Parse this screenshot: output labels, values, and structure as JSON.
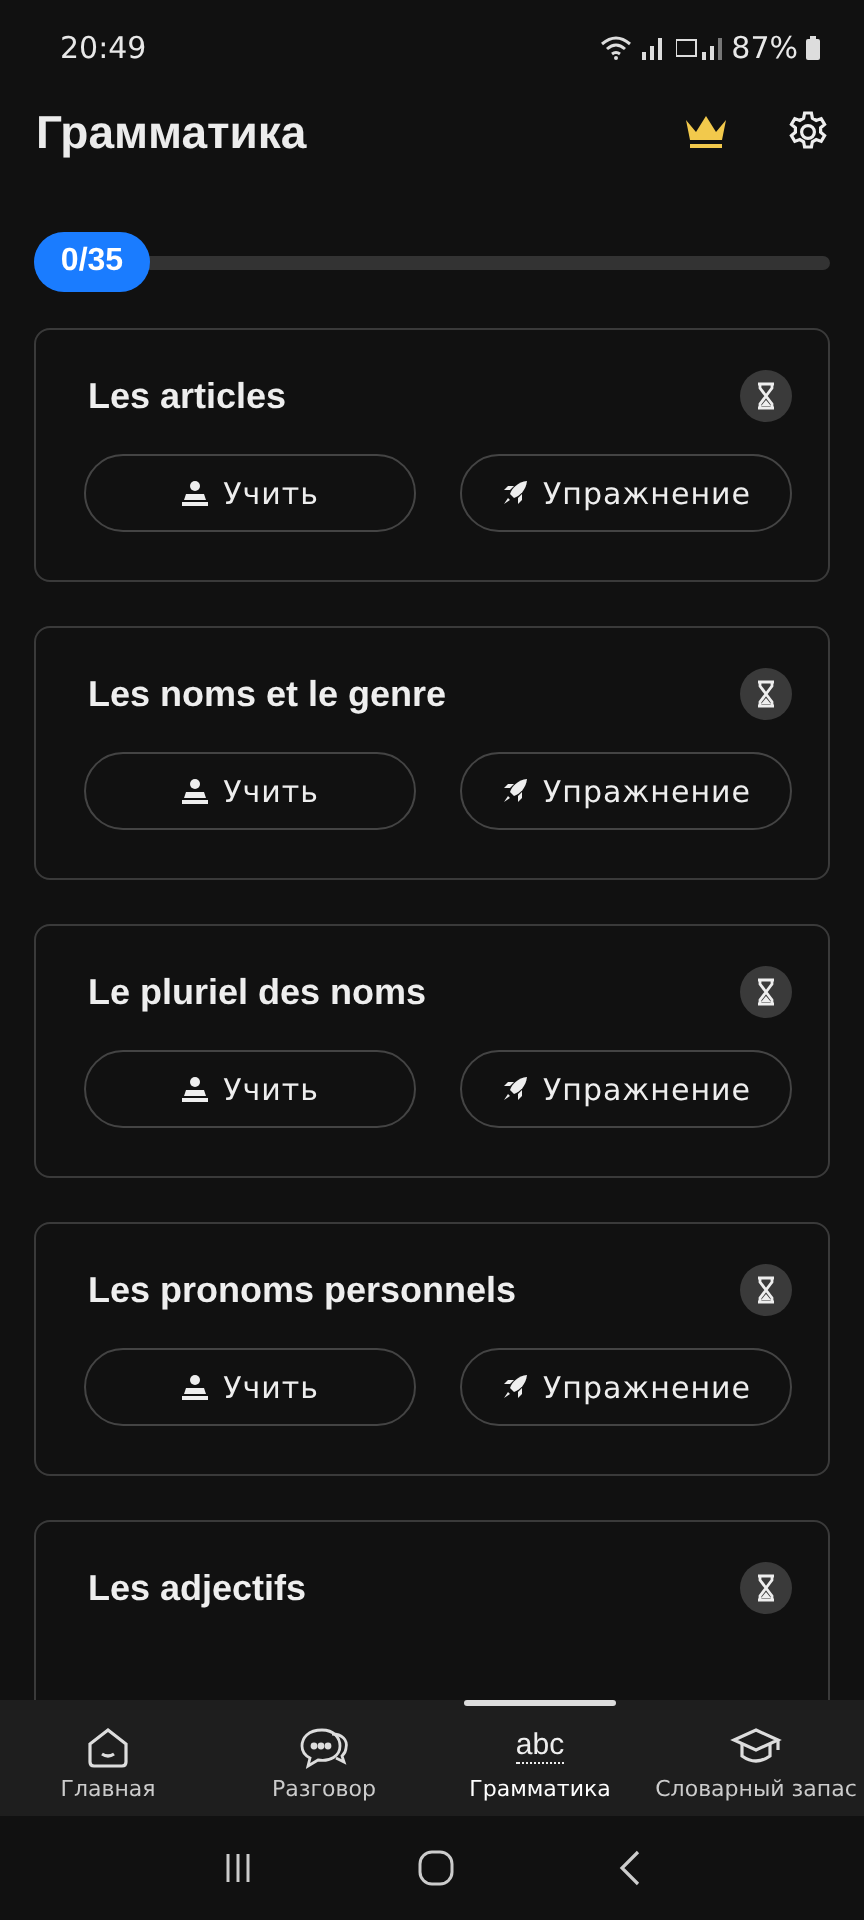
{
  "status_bar": {
    "time": "20:49",
    "battery": "87%"
  },
  "header": {
    "title": "Грамматика"
  },
  "progress": {
    "label": "0/35",
    "level": 0
  },
  "lessons": [
    {
      "title": "Les articles",
      "buttons": [
        {
          "kind": "learn",
          "label": "Учить"
        },
        {
          "kind": "practice",
          "label": "Упражнение"
        }
      ]
    },
    {
      "title": "Les noms et le genre",
      "buttons": [
        {
          "kind": "learn",
          "label": "Учить"
        },
        {
          "kind": "practice",
          "label": "Упражнение"
        }
      ]
    },
    {
      "title": "Le pluriel des noms",
      "buttons": [
        {
          "kind": "learn",
          "label": "Учить"
        },
        {
          "kind": "practice",
          "label": "Упражнение"
        }
      ]
    },
    {
      "title": "Les pronoms personnels",
      "buttons": [
        {
          "kind": "learn",
          "label": "Учить"
        },
        {
          "kind": "practice",
          "label": "Упражнение"
        }
      ]
    },
    {
      "title": "Les adjectifs"
    }
  ],
  "tabs": [
    {
      "kind": "home",
      "label": "Главная",
      "selected": false
    },
    {
      "kind": "chat",
      "label": "Разговор",
      "selected": false
    },
    {
      "kind": "abc",
      "icon_text": "abc",
      "label": "Грамматика",
      "selected": true
    },
    {
      "kind": "cap",
      "label": "Словарный запас",
      "selected": false
    }
  ]
}
